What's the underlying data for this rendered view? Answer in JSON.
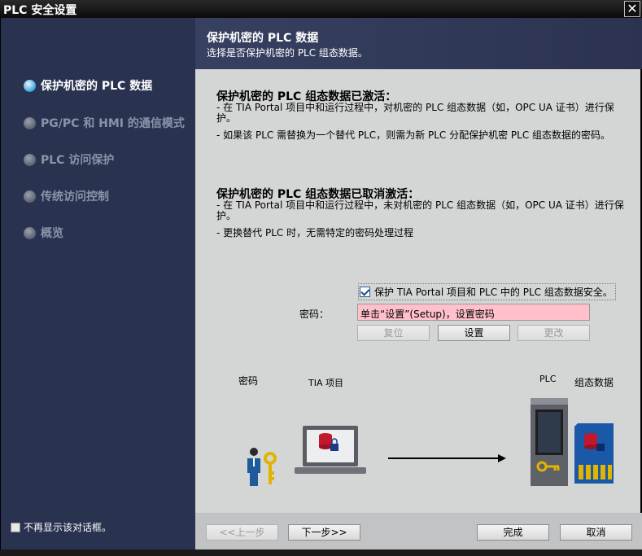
{
  "window": {
    "title": "PLC 安全设置",
    "close_glyph": "✕"
  },
  "sidebar": {
    "steps": [
      {
        "label": "保护机密的 PLC 数据",
        "active": true
      },
      {
        "label": "PG/PC 和 HMI 的通信模式",
        "active": false
      },
      {
        "label": "PLC 访问保护",
        "active": false
      },
      {
        "label": "传统访问控制",
        "active": false
      },
      {
        "label": "概览",
        "active": false
      }
    ],
    "dont_show_label": "不再显示该对话框。"
  },
  "header": {
    "title": "保护机密的 PLC 数据",
    "subtitle": "选择是否保护机密的 PLC 组态数据。"
  },
  "content": {
    "activated": {
      "title": "保护机密的 PLC 组态数据已激活：",
      "line1": "- 在 TIA Portal 项目中和运行过程中，对机密的 PLC 组态数据（如，OPC UA 证书）进行保护。",
      "line2": "- 如果该 PLC 需替换为一个替代 PLC，则需为新 PLC 分配保护机密 PLC 组态数据的密码。"
    },
    "deactivated": {
      "title": "保护机密的 PLC 组态数据已取消激活：",
      "line1": "- 在 TIA Portal 项目中和运行过程中，未对机密的 PLC 组态数据（如，OPC UA 证书）进行保护。",
      "line2": "- 更换替代 PLC 时，无需特定的密码处理过程"
    },
    "protect_checkbox": {
      "label": "保护 TIA Portal 项目和 PLC 中的 PLC 组态数据安全。",
      "checked": true
    },
    "password": {
      "label": "密码：",
      "value": "单击“设置”(Setup)，设置密码"
    },
    "buttons": {
      "reset": "复位",
      "setup": "设置",
      "change": "更改"
    },
    "diagram": {
      "password_label": "密码",
      "tia_label": "TIA 项目",
      "plc_label": "PLC",
      "config_label": "组态数据"
    }
  },
  "footer": {
    "back": "<<上一步",
    "next": "下一步>>",
    "finish": "完成",
    "cancel": "取消"
  },
  "colors": {
    "sidebar_bg": "#29324f",
    "active_bullet": "#4aa8e2",
    "password_bg": "#ffc0cb",
    "content_bg": "#d4d5d5"
  }
}
